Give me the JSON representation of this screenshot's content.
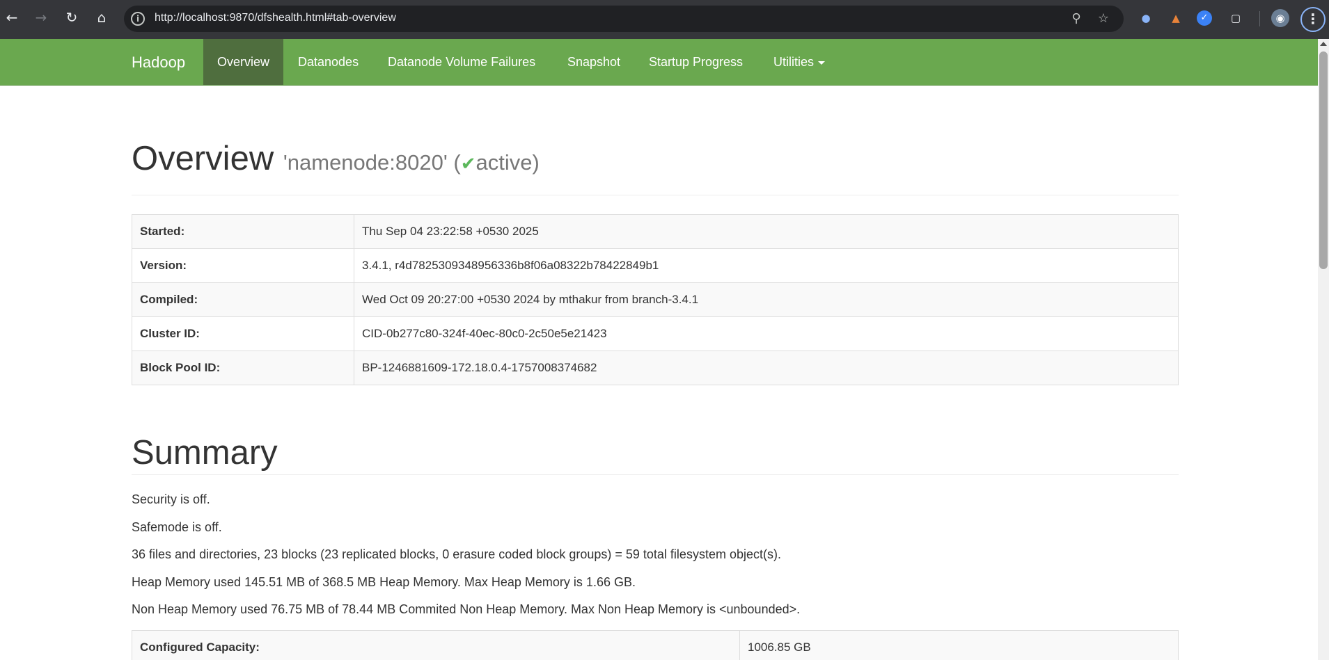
{
  "browser": {
    "url": "http://localhost:9870/dfshealth.html#tab-overview",
    "icons": [
      "back-arrow-icon",
      "forward-arrow-icon",
      "reload-icon",
      "home-icon",
      "site-info-icon",
      "zoom-icon",
      "bookmark-star-icon",
      "extensions-icon",
      "profile-avatar-icon",
      "menu-kebab-icon"
    ],
    "ext_badge": "0"
  },
  "navbar": {
    "brand": "Hadoop",
    "items": [
      "Overview",
      "Datanodes",
      "Datanode Volume Failures",
      "Snapshot",
      "Startup Progress",
      "Utilities"
    ],
    "active_item": "Overview",
    "color": "#6aa84f",
    "active_color": "#4f6e3e"
  },
  "overview": {
    "title": "Overview",
    "host": "'namenode:8020' (",
    "status": "active",
    "status_close": ")",
    "rows": [
      {
        "label": "Started:",
        "value": "Thu Sep 04 23:22:58 +0530 2025"
      },
      {
        "label": "Version:",
        "value": "3.4.1, r4d7825309348956336b8f06a08322b78422849b1"
      },
      {
        "label": "Compiled:",
        "value": "Wed Oct 09 20:27:00 +0530 2024 by mthakur from branch-3.4.1"
      },
      {
        "label": "Cluster ID:",
        "value": "CID-0b277c80-324f-40ec-80c0-2c50e5e21423"
      },
      {
        "label": "Block Pool ID:",
        "value": "BP-1246881609-172.18.0.4-1757008374682"
      }
    ]
  },
  "summary": {
    "title": "Summary",
    "lines": [
      "Security is off.",
      "Safemode is off.",
      "36 files and directories, 23 blocks (23 replicated blocks, 0 erasure coded block groups) = 59 total filesystem object(s).",
      "Heap Memory used 145.51 MB of 368.5 MB Heap Memory. Max Heap Memory is 1.66 GB.",
      "Non Heap Memory used 76.75 MB of 78.44 MB Commited Non Heap Memory. Max Non Heap Memory is <unbounded>."
    ],
    "capacity": {
      "label": "Configured Capacity:",
      "value": "1006.85 GB"
    }
  }
}
